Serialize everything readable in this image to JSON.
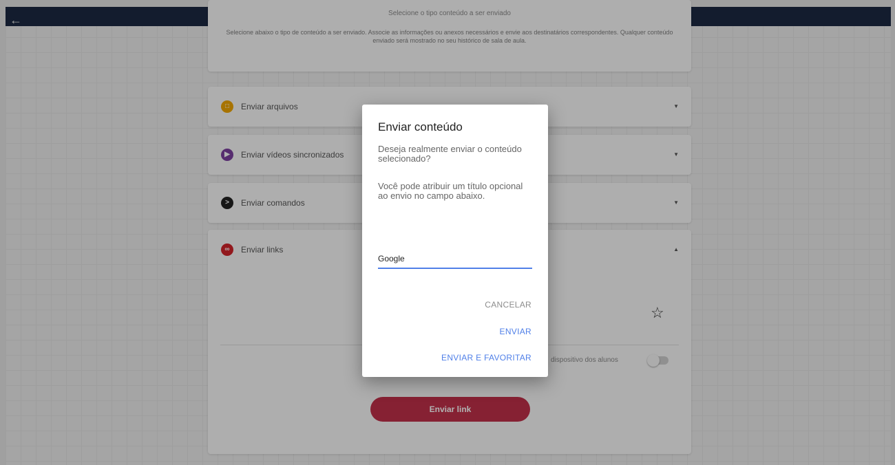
{
  "header": {
    "back_icon": "arrow-left-icon",
    "bar_color": "#1c2942"
  },
  "intro": {
    "title": "Selecione o tipo conteúdo a ser enviado",
    "description": "Selecione abaixo o tipo de conteúdo a ser enviado. Associe as informações ou anexos necessários e envie aos destinatários correspondentes. Qualquer conteúdo enviado será mostrado no seu histórico de sala de aula."
  },
  "accordion": [
    {
      "label": "Enviar arquivos",
      "icon": "file-icon",
      "color": "#f0a500",
      "expanded": false
    },
    {
      "label": "Enviar vídeos sincronizados",
      "icon": "video-icon",
      "color": "#7b3fa0",
      "expanded": false
    },
    {
      "label": "Enviar comandos",
      "icon": "terminal-icon",
      "color": "#222222",
      "expanded": false
    },
    {
      "label": "Enviar links",
      "icon": "link-icon",
      "color": "#d2232a",
      "expanded": true
    }
  ],
  "links_panel": {
    "star_icon": "star-outline-icon",
    "toggle_label": "dispositivo dos alunos",
    "toggle_on": false,
    "send_button": "Enviar link",
    "accent_color": "#c1304a"
  },
  "dialog": {
    "title": "Enviar conteúdo",
    "text1": "Deseja realmente enviar o conteúdo selecionado?",
    "text2": "Você pode atribuir um título opcional ao envio no campo abaixo.",
    "input_value": "Google",
    "cancel": "CANCELAR",
    "send": "ENVIAR",
    "send_favorite": "ENVIAR E FAVORITAR",
    "accent_color": "#4f7fe8"
  }
}
